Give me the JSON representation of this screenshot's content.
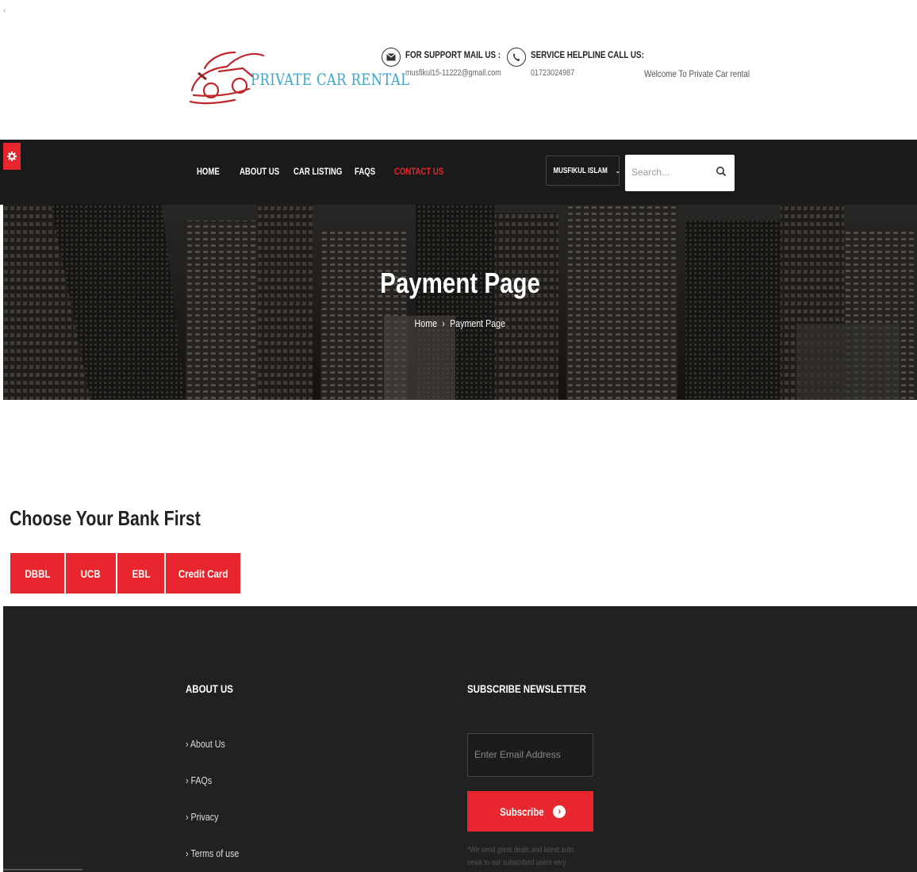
{
  "header": {
    "back_glyph": "‹",
    "logo_text": "PRIVATE CAR RENTAL",
    "support": {
      "title": "FOR SUPPORT MAIL US :",
      "value": "musfikul15-11222@gmail.com",
      "icon": "envelope-icon"
    },
    "helpline": {
      "title": "SERVICE HELPLINE CALL US:",
      "value": "01723024987",
      "icon": "phone-icon"
    },
    "welcome": "Welcome To Private Car rental"
  },
  "nav": {
    "items": [
      {
        "label": "HOME",
        "active": false
      },
      {
        "label": "ABOUT US",
        "active": false
      },
      {
        "label": "CAR LISTING",
        "active": false
      },
      {
        "label": "FAQS",
        "active": false
      },
      {
        "label": "CONTACT US",
        "active": true
      }
    ],
    "user_label": "MUSFIKUL ISLAM",
    "search_placeholder": "Search...",
    "accent": "#e8262d"
  },
  "hero": {
    "title": "Payment Page",
    "breadcrumb_home": "Home",
    "breadcrumb_separator": "›",
    "breadcrumb_current": "Payment Page"
  },
  "bank": {
    "title": "Choose Your Bank First",
    "buttons": [
      "DBBL",
      "UCB",
      "EBL",
      "Credit Card"
    ]
  },
  "footer": {
    "about_heading": "ABOUT US",
    "links": [
      "› About Us",
      "› FAQs",
      "› Privacy",
      "› Terms of use"
    ],
    "newsletter_heading": "SUBSCRIBE NEWSLETTER",
    "email_placeholder": "Enter Email Address",
    "subscribe_label": "Subscribe",
    "note": "*We send great deals and latest auto news to our subscribed users very week."
  },
  "colors": {
    "accent": "#e8262d",
    "dark": "#1a1a1a",
    "footer": "#212121",
    "logo": "#3aa6c9"
  }
}
